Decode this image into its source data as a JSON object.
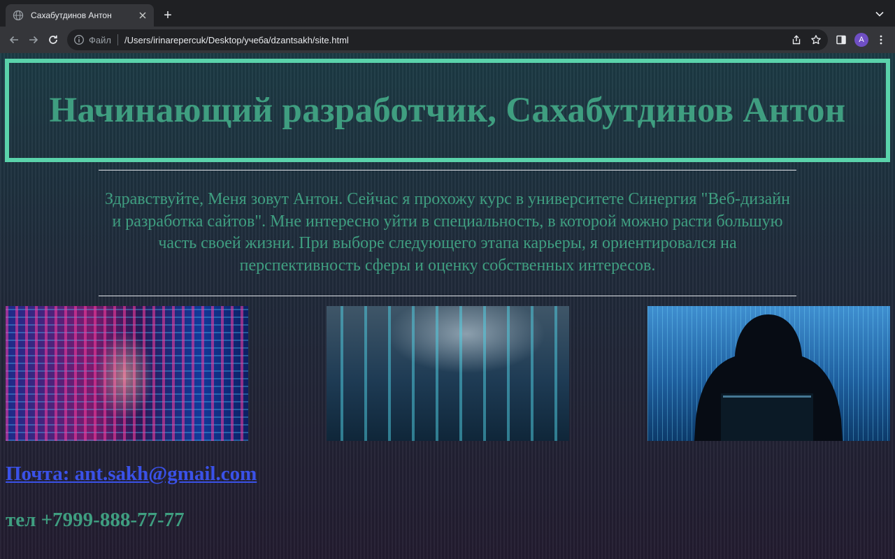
{
  "browser": {
    "tab": {
      "title": "Сахабутдинов Антон",
      "favicon": "globe-icon"
    },
    "new_tab": "+",
    "omnibox": {
      "scheme_label": "Файл",
      "url": "/Users/irinarepercuk/Desktop/учеба/dzantsakh/site.html"
    },
    "profile_initial": "A",
    "colors": {
      "frame": "#1f2023",
      "toolbar": "#35363a",
      "omnibox": "#202124",
      "avatar": "#6f4fc4"
    }
  },
  "page": {
    "title": "Начинающий разработчик, Сахабутдинов Антон",
    "intro": "Здравствуйте, Меня зовут Антон. Сейчас я прохожу курс в университете Синергия \"Веб-дизайн и разработка сайтов\". Мне интересно уйти в специальность, в которой можно расти большую часть своей жизни. При выборе следующего этапа карьеры, я ориентировался на перспективность сферы и оценку собственных интересов.",
    "images": [
      "woman-code-photo",
      "analytics-tablet-photo",
      "hooded-hacker-photo"
    ],
    "email_link": "Почта: ant.sakh@gmail.com",
    "phone": "тел +7999-888-77-77",
    "colors": {
      "accent": "#5ad3ab",
      "text_green": "#3f9e80",
      "link": "#3a51e8"
    }
  }
}
